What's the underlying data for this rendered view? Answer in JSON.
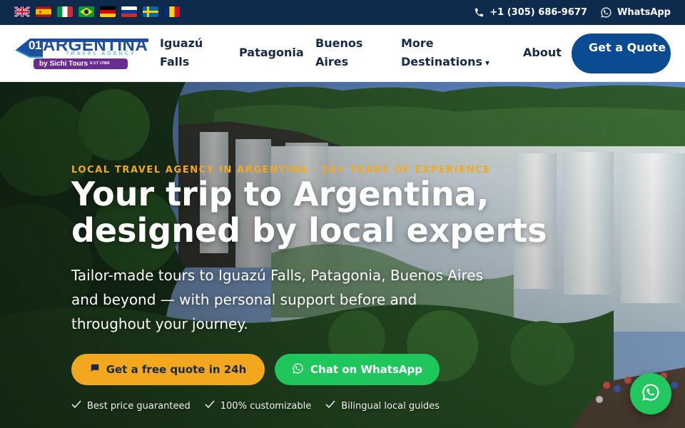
{
  "topbar": {
    "languages": [
      {
        "name": "English",
        "icon": "uk-flag-icon"
      },
      {
        "name": "Español",
        "icon": "spain-flag-icon"
      },
      {
        "name": "Italiano",
        "icon": "italy-flag-icon"
      },
      {
        "name": "Português",
        "icon": "brazil-flag-icon"
      },
      {
        "name": "Deutsch",
        "icon": "germany-flag-icon"
      },
      {
        "name": "Русский",
        "icon": "russia-flag-icon"
      },
      {
        "name": "Svenska",
        "icon": "sweden-flag-icon"
      },
      {
        "name": "Română",
        "icon": "romania-flag-icon"
      }
    ],
    "phone": "+1 (305) 686-9677",
    "whatsapp_label": "WhatsApp"
  },
  "logo": {
    "number": "01",
    "word": "ARGENTINA",
    "tagline": "TRAVEL AGENCY",
    "byline": "by Sichi Tours",
    "license": "E.V.T 17869"
  },
  "nav": {
    "items": [
      {
        "label": "Iguazú Falls"
      },
      {
        "label": "Patagonia"
      },
      {
        "label": "Buenos Aires"
      },
      {
        "label": "More Destinations",
        "caret": "▾"
      },
      {
        "label": "About"
      }
    ],
    "cta_label": "Get a Quote"
  },
  "hero": {
    "eyebrow": "LOCAL TRAVEL AGENCY IN ARGENTINA · 20+ YEARS OF EXPERIENCE",
    "title": "Your trip to Argentina, designed by local experts",
    "subtitle": "Tailor-made tours to Iguazú Falls, Patagonia, Buenos Aires and beyond — with personal support before and throughout your journey.",
    "cta_quote": "Get a free quote in 24h",
    "cta_whatsapp": "Chat on WhatsApp",
    "perks": [
      "Best price guaranteed",
      "100% customizable",
      "Bilingual local guides"
    ]
  },
  "colors": {
    "topbar_bg": "#0e2b4e",
    "brand_blue": "#0b4b91",
    "accent_orange": "#f3a71f",
    "whatsapp_green": "#1ec65c"
  }
}
